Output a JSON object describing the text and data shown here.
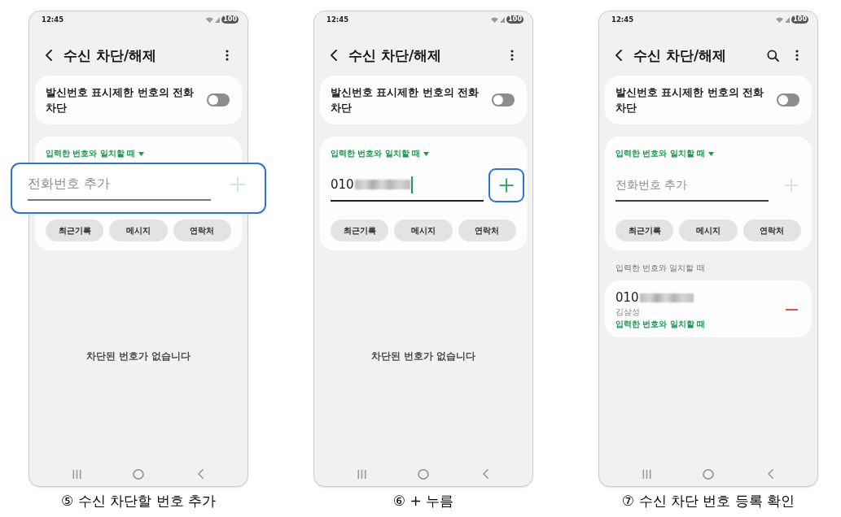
{
  "screens": [
    {
      "status_bar": {
        "time": "12:45",
        "battery": "100"
      },
      "header": {
        "title": "수신 차단/해제",
        "actions": [
          {
            "kind": "more"
          }
        ]
      },
      "caller_id_card": {
        "label": "발신번호 표시제한 번호의 전화 차단",
        "on": false
      },
      "block_card": {
        "match_rule": "입력한 번호와 일치할 때",
        "input": {
          "placeholder": "전화번호 추가",
          "focused": false,
          "highlighted": true
        },
        "add_button": {
          "enabled": false,
          "highlighted": false
        },
        "buttons": [
          "최근기록",
          "메시지",
          "연락처"
        ]
      },
      "empty_message": "차단된 번호가 없습니다",
      "caption": "⑤ 수신 차단할 번호 추가"
    },
    {
      "status_bar": {
        "time": "12:45",
        "battery": "100"
      },
      "header": {
        "title": "수신 차단/해제",
        "actions": [
          {
            "kind": "more"
          }
        ]
      },
      "caller_id_card": {
        "label": "발신번호 표시제한 번호의 전화 차단",
        "on": false
      },
      "block_card": {
        "match_rule": "입력한 번호와 일치할 때",
        "input": {
          "value": "010",
          "redacted": true,
          "focused": true,
          "highlighted": false
        },
        "add_button": {
          "enabled": true,
          "highlighted": true
        },
        "buttons": [
          "최근기록",
          "메시지",
          "연락처"
        ]
      },
      "empty_message": "차단된 번호가 없습니다",
      "caption": "⑥ + 누름"
    },
    {
      "status_bar": {
        "time": "12:45",
        "battery": "100"
      },
      "header": {
        "title": "수신 차단/해제",
        "actions": [
          {
            "kind": "search"
          },
          {
            "kind": "more"
          }
        ]
      },
      "caller_id_card": {
        "label": "발신번호 표시제한 번호의 전화 차단",
        "on": false
      },
      "block_card": {
        "match_rule": "입력한 번호와 일치할 때",
        "input": {
          "placeholder": "전화번호 추가",
          "focused": false,
          "highlighted": false
        },
        "add_button": {
          "enabled": false,
          "highlighted": false
        },
        "buttons": [
          "최근기록",
          "메시지",
          "연락처"
        ]
      },
      "blocked_list": {
        "section_label": "입력한 번호와 일치할 때",
        "items": [
          {
            "number": "010",
            "redacted": true,
            "name": "김삼성",
            "rule": "입력한 번호와 일치할 때"
          }
        ]
      },
      "caption": "⑦ 수신 차단 번호 등록 확인"
    }
  ]
}
